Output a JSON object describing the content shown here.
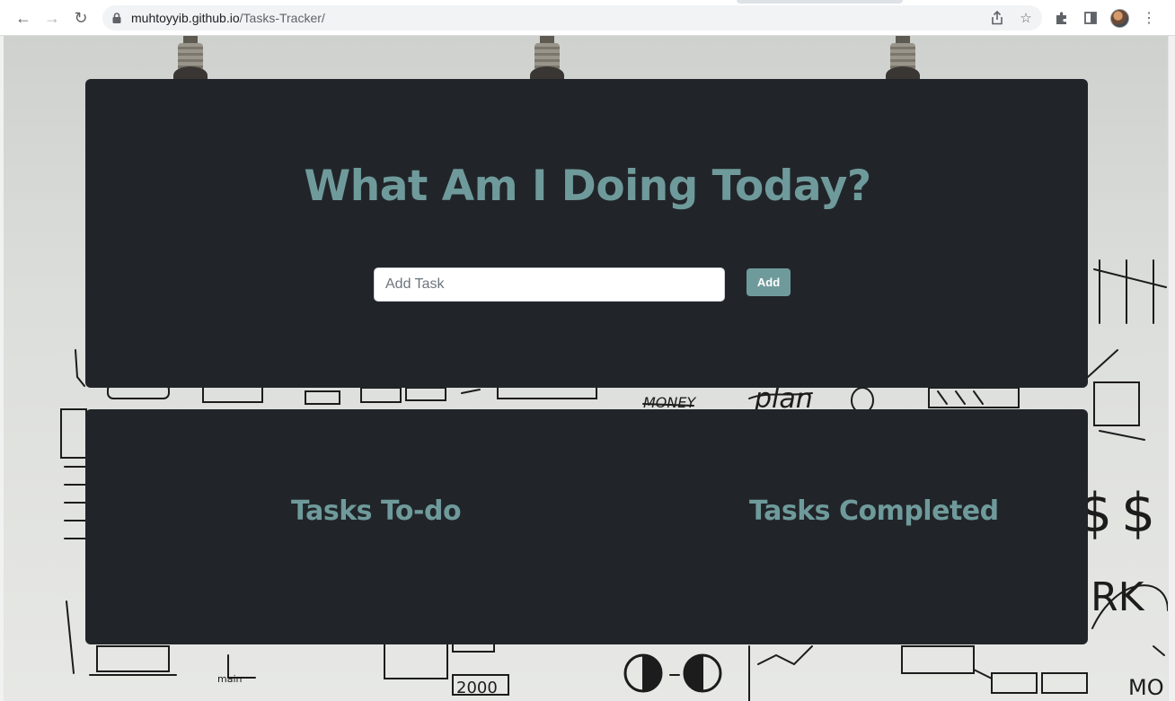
{
  "browser": {
    "url_host": "muhtoyyib.github.io",
    "url_path": "/Tasks-Tracker/"
  },
  "app": {
    "headline": "What Am I Doing Today?",
    "task_input": {
      "placeholder": "Add Task",
      "value": ""
    },
    "add_button_label": "Add",
    "columns": {
      "todo_title": "Tasks To-do",
      "completed_title": "Tasks Completed"
    }
  },
  "colors": {
    "accent": "#6f9a9b",
    "card_bg": "#212529"
  }
}
